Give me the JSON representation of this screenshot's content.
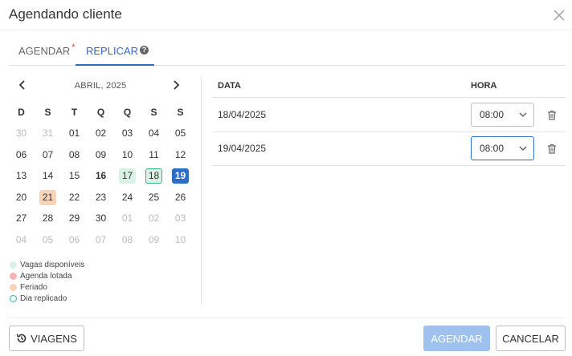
{
  "dialog": {
    "title": "Agendando cliente",
    "close_icon": "close-icon"
  },
  "tabs": [
    {
      "label": "AGENDAR",
      "required_marker": "*"
    },
    {
      "label": "REPLICAR",
      "help_icon": "?"
    }
  ],
  "calendar": {
    "month_label": "ABRIL, 2025",
    "weekdays": [
      "D",
      "S",
      "T",
      "Q",
      "Q",
      "S",
      "S"
    ],
    "weeks": [
      [
        "30",
        "31",
        "01",
        "02",
        "03",
        "04",
        "05"
      ],
      [
        "06",
        "07",
        "08",
        "09",
        "10",
        "11",
        "12"
      ],
      [
        "13",
        "14",
        "15",
        "16",
        "17",
        "18",
        "19"
      ],
      [
        "20",
        "21",
        "22",
        "23",
        "24",
        "25",
        "26"
      ],
      [
        "27",
        "28",
        "29",
        "30",
        "01",
        "02",
        "03"
      ],
      [
        "04",
        "05",
        "06",
        "07",
        "08",
        "09",
        "10"
      ]
    ],
    "day_states": [
      [
        "out",
        "out",
        "",
        "",
        "",
        "",
        ""
      ],
      [
        "",
        "",
        "",
        "",
        "",
        "",
        ""
      ],
      [
        "",
        "",
        "",
        "today",
        "avail",
        "replic",
        "selected"
      ],
      [
        "",
        "holiday",
        "",
        "",
        "",
        "",
        ""
      ],
      [
        "",
        "",
        "",
        "",
        "out",
        "out",
        "out"
      ],
      [
        "out",
        "out",
        "out",
        "out",
        "out",
        "out",
        "out"
      ]
    ]
  },
  "legend": [
    {
      "label": "Vagas disponíveis",
      "color": "#daf2e6",
      "style": "fill"
    },
    {
      "label": "Agenda lotada",
      "color": "#f2b4b4",
      "style": "fill"
    },
    {
      "label": "Feriado",
      "color": "#f8d3b8",
      "style": "fill"
    },
    {
      "label": "Dia replicado",
      "color": "#3bb08f",
      "style": "ring"
    }
  ],
  "table": {
    "col_date": "DATA",
    "col_hour": "HORA",
    "rows": [
      {
        "date": "18/04/2025",
        "hour": "08:00"
      },
      {
        "date": "19/04/2025",
        "hour": "08:00"
      }
    ]
  },
  "footer": {
    "viagens_label": "VIAGENS",
    "agendar_label": "AGENDAR",
    "cancelar_label": "CANCELAR"
  },
  "colors": {
    "accent": "#2f6dc4",
    "primary_disabled": "#9ec1ee"
  }
}
